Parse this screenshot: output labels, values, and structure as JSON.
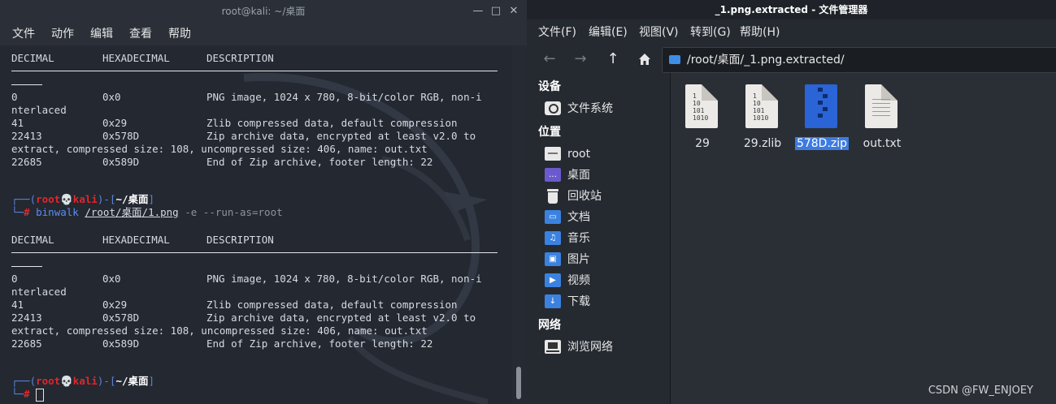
{
  "terminal": {
    "title": "root@kali: ~/桌面",
    "menu": [
      "文件",
      "动作",
      "编辑",
      "查看",
      "帮助"
    ],
    "header": [
      "DECIMAL",
      "HEXADECIMAL",
      "DESCRIPTION"
    ],
    "rows": [
      [
        "0",
        "0x0",
        "PNG image, 1024 x 780, 8-bit/color RGB, non-i"
      ],
      [
        "nterlaced",
        "",
        ""
      ],
      [
        "41",
        "0x29",
        "Zlib compressed data, default compression"
      ],
      [
        "22413",
        "0x578D",
        "Zip archive data, encrypted at least v2.0 to"
      ],
      [
        "extract, compressed size: 108, uncompressed size: 406, name: out.txt",
        "",
        ""
      ],
      [
        "22685",
        "0x589D",
        "End of Zip archive, footer length: 22"
      ]
    ],
    "prompt": {
      "open": "┌──(",
      "user": "root",
      "skull": "💀",
      "host": "kali",
      "mid": ")-[",
      "path": "~/桌面",
      "close": "]",
      "corner": "└─",
      "hash": "#"
    },
    "command": {
      "bin": "binwalk",
      "arg_parts": [
        "/root",
        "/",
        "桌面",
        "/",
        "1.png"
      ],
      "flags": " -e --run-as=root"
    }
  },
  "filemanager": {
    "title": "_1.png.extracted - 文件管理器",
    "menu": [
      "文件(F)",
      "编辑(E)",
      "视图(V)",
      "转到(G)",
      "帮助(H)"
    ],
    "path": "/root/桌面/_1.png.extracted/",
    "sections": [
      {
        "title": "设备",
        "items": [
          {
            "label": "文件系统",
            "icon": "drive-icon"
          }
        ]
      },
      {
        "title": "位置",
        "items": [
          {
            "label": "root",
            "icon": "home-folder-icon"
          },
          {
            "label": "桌面",
            "icon": "desktop-folder-icon"
          },
          {
            "label": "回收站",
            "icon": "trash-icon"
          },
          {
            "label": "文档",
            "icon": "documents-folder-icon"
          },
          {
            "label": "音乐",
            "icon": "music-folder-icon"
          },
          {
            "label": "图片",
            "icon": "pictures-folder-icon"
          },
          {
            "label": "视频",
            "icon": "videos-folder-icon"
          },
          {
            "label": "下载",
            "icon": "downloads-folder-icon"
          }
        ]
      },
      {
        "title": "网络",
        "items": [
          {
            "label": "浏览网络",
            "icon": "network-icon"
          }
        ]
      }
    ],
    "files": [
      {
        "name": "29",
        "type": "binary",
        "selected": false
      },
      {
        "name": "29.zlib",
        "type": "binary",
        "selected": false
      },
      {
        "name": "578D.zip",
        "type": "zip",
        "selected": true
      },
      {
        "name": "out.txt",
        "type": "text",
        "selected": false
      }
    ],
    "binary_glyph": "1\n10\n101\n1010"
  },
  "watermark": "CSDN @FW_ENJOEY",
  "colors": {
    "accent": "#3d7be0",
    "prompt_red": "#e2262a",
    "prompt_blue": "#5c84d8"
  }
}
